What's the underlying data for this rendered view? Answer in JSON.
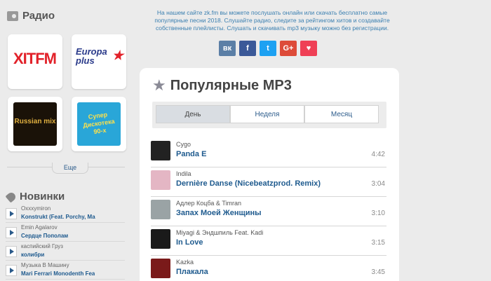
{
  "sidebar": {
    "radio_title": "Радио",
    "stations": [
      {
        "name": "ХІТ FM",
        "logo_text": "ХІТFM"
      },
      {
        "name": "Europa Plus",
        "logo_text": "Europa plus"
      },
      {
        "name": "Russian Mix",
        "logo_text": "Russian mix"
      },
      {
        "name": "Супер Дискотека 90-х",
        "logo_text": "Супер Дискотека 90-х"
      }
    ],
    "more_label": "Еще",
    "new_title": "Новинки",
    "new_items": [
      {
        "artist": "Oxxxymiron",
        "title": "Konstrukt (Feat. Porchy, Ma"
      },
      {
        "artist": "Emin Agalarov",
        "title": "Сердце Пополам"
      },
      {
        "artist": "каспийский Груз",
        "title": "колибри"
      },
      {
        "artist": "Музыка В Машину",
        "title": "Mari Ferrari Monodenth Fea"
      }
    ]
  },
  "main": {
    "intro": "На нашем сайте zk.fm вы можете послушать онлайн или скачать бесплатно самые популярные песни 2018. Слушайте радио, следите за рейтингом хитов и создавайте собственные плейлисты. Слушать и скачивать mp3 музыку можно без регистрации.",
    "social": [
      {
        "icon": "vk-icon",
        "label": "вк",
        "color": "#5b7fa6"
      },
      {
        "icon": "facebook-icon",
        "label": "f",
        "color": "#3b5998"
      },
      {
        "icon": "twitter-icon",
        "label": "t",
        "color": "#1da1f2"
      },
      {
        "icon": "googleplus-icon",
        "label": "G+",
        "color": "#dd4b39"
      },
      {
        "icon": "pocket-icon",
        "label": "♥",
        "color": "#ef4056"
      }
    ],
    "popular_title": "Популярные MP3",
    "tabs": [
      {
        "label": "День",
        "active": true
      },
      {
        "label": "Неделя",
        "active": false
      },
      {
        "label": "Месяц",
        "active": false
      }
    ],
    "tracks": [
      {
        "artist": "Cygo",
        "title": "Panda E",
        "duration": "4:42",
        "cover_color": "#222222"
      },
      {
        "artist": "Indila",
        "title": "Dernière Danse (Nicebeatzprod. Remix)",
        "duration": "3:04",
        "cover_color": "#e4b6c4"
      },
      {
        "artist": "Адлер Коцба & Timran",
        "title": "Запах Моей Женщины",
        "duration": "3:10",
        "cover_color": "#9aa3a5"
      },
      {
        "artist": "Miyagi & Эндшпиль Feat. Kadi",
        "title": "In Love",
        "duration": "3:15",
        "cover_color": "#1a1a1a"
      },
      {
        "artist": "Kazka",
        "title": "Плакала",
        "duration": "3:45",
        "cover_color": "#7a1a1a"
      }
    ]
  }
}
